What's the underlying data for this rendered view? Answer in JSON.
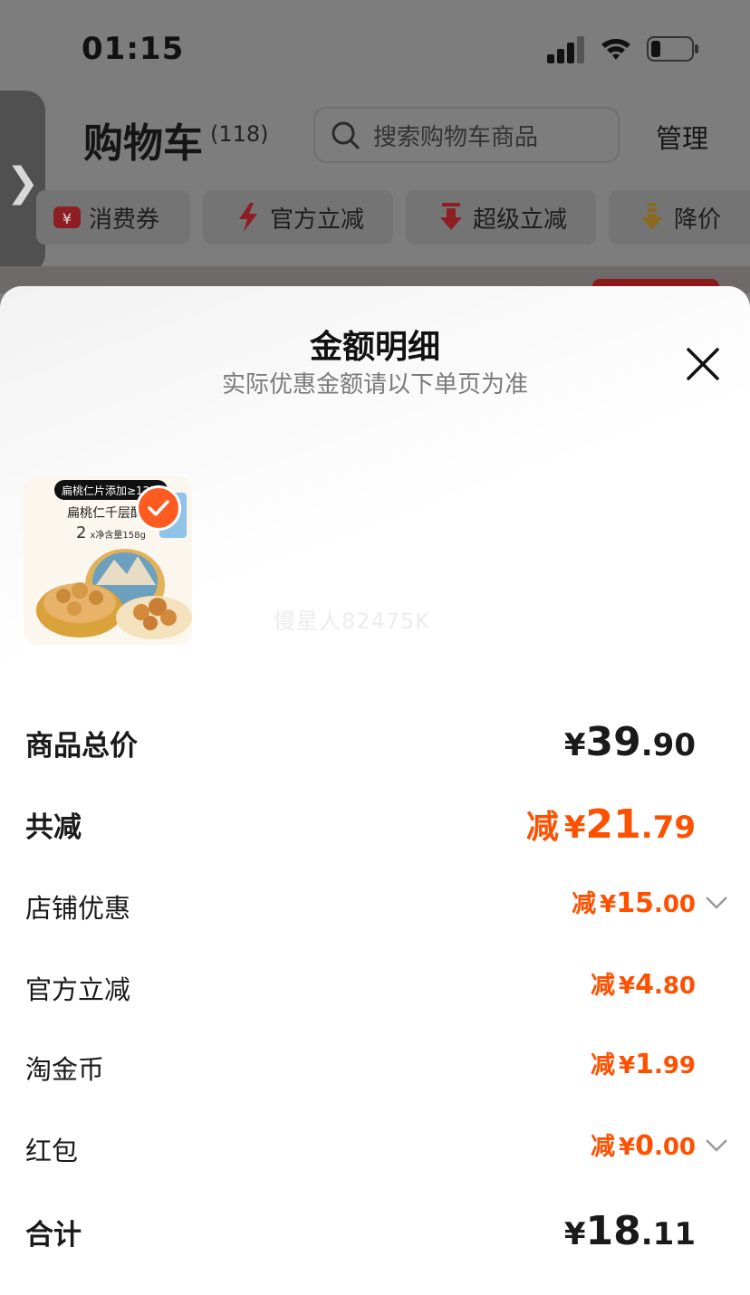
{
  "status_bar": {
    "time": "01:15"
  },
  "cart": {
    "title": "购物车",
    "count": "(118)",
    "search_placeholder": "搜索购物车商品",
    "manage_label": "管理",
    "chips": [
      {
        "label": "消费券",
        "icon": "coupon-icon"
      },
      {
        "label": "官方立减",
        "icon": "lightning-icon"
      },
      {
        "label": "超级立减",
        "icon": "arrow-down-icon"
      },
      {
        "label": "降价",
        "icon": "price-drop-icon"
      }
    ],
    "side_handle_icon": "chevron-right-icon"
  },
  "sheet": {
    "title": "金额明细",
    "subtitle": "实际优惠金额请以下单页为准",
    "close_icon": "close-icon",
    "product": {
      "tag": "扁桃仁片添加≥12%",
      "name": "扁桃仁千层酥",
      "qty": "2",
      "net": "x净含量158g",
      "selected": true
    },
    "watermark": "慢星人82475K",
    "rows": [
      {
        "label": "商品总价",
        "prefix": "",
        "currency": "¥",
        "int": "39",
        "dec": ".90",
        "style": "total"
      },
      {
        "label": "共减",
        "prefix": "减",
        "currency": "¥",
        "int": "21",
        "dec": ".79",
        "style": "discount-total"
      },
      {
        "label": "店铺优惠",
        "prefix": "减",
        "currency": "¥",
        "int": "15",
        "dec": ".00",
        "style": "discount",
        "expandable": true
      },
      {
        "label": "官方立减",
        "prefix": "减",
        "currency": "¥",
        "int": "4",
        "dec": ".80",
        "style": "discount"
      },
      {
        "label": "淘金币",
        "prefix": "减",
        "currency": "¥",
        "int": "1",
        "dec": ".99",
        "style": "discount"
      },
      {
        "label": "红包",
        "prefix": "减",
        "currency": "¥",
        "int": "0",
        "dec": ".00",
        "style": "discount",
        "expandable": true
      },
      {
        "label": "合计",
        "prefix": "",
        "currency": "¥",
        "int": "18",
        "dec": ".11",
        "style": "total"
      }
    ]
  },
  "colors": {
    "accent": "#ff5000",
    "check": "#ff5a1f"
  }
}
